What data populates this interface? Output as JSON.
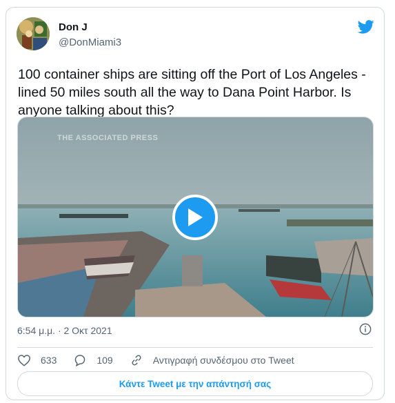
{
  "tweet": {
    "author_name": "Don J",
    "author_handle": "@DonMiami3",
    "text": "100 container ships are sitting off the Port of Los Angeles - lined 50 miles south all the way to Dana Point Harbor. Is anyone talking about this?",
    "timestamp": "6:54 μ.μ. · 2 Οκτ 2021",
    "media": {
      "watermark": "THE ASSOCIATED PRESS",
      "type": "video"
    }
  },
  "actions": {
    "likes": "633",
    "replies": "109",
    "copy_link_label": "Αντιγραφή συνδέσμου στο Tweet"
  },
  "reply_button": "Κάντε Tweet με την απάντησή σας",
  "colors": {
    "accent": "#1d9bf0",
    "text_secondary": "#536471",
    "border": "#cfd9de"
  },
  "icons": [
    "twitter-bird-icon",
    "play-icon",
    "info-icon",
    "heart-icon",
    "reply-bubble-icon",
    "link-icon"
  ]
}
